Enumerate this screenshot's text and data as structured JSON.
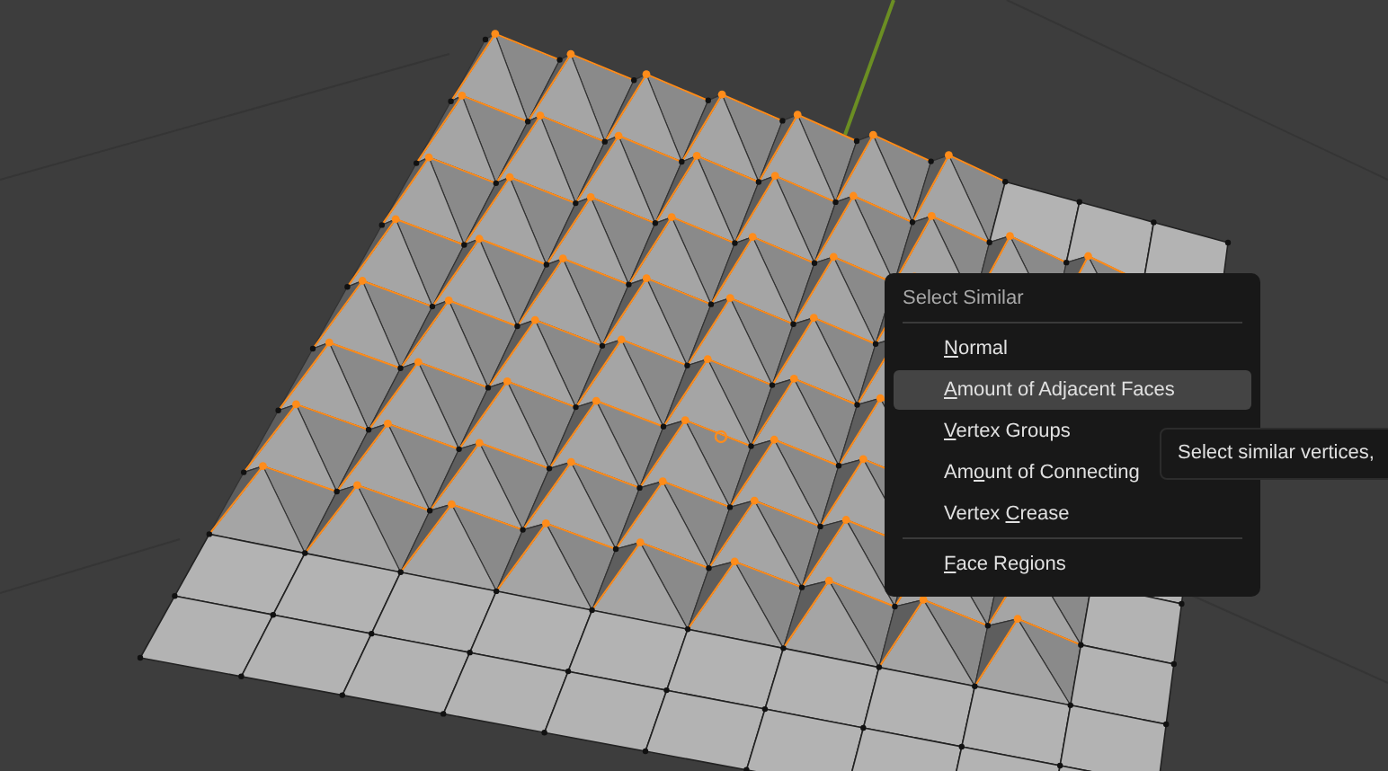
{
  "menu": {
    "title": "Select Similar",
    "items": [
      {
        "kind": "item",
        "key": "N",
        "post": "ormal",
        "selected": false
      },
      {
        "kind": "item",
        "key": "A",
        "post": "mount of Adjacent Faces",
        "selected": true
      },
      {
        "kind": "item",
        "key": "V",
        "post": "ertex Groups",
        "selected": false
      },
      {
        "kind": "item",
        "pre": "Am",
        "key": "o",
        "post": "unt of Connecting",
        "selected": false
      },
      {
        "kind": "item",
        "pre": "Vertex ",
        "key": "C",
        "post": "rease",
        "selected": false
      },
      {
        "kind": "separator"
      },
      {
        "kind": "item",
        "key": "F",
        "post": "ace Regions",
        "selected": false
      }
    ]
  },
  "tooltip": {
    "text": "Select similar vertices,"
  }
}
